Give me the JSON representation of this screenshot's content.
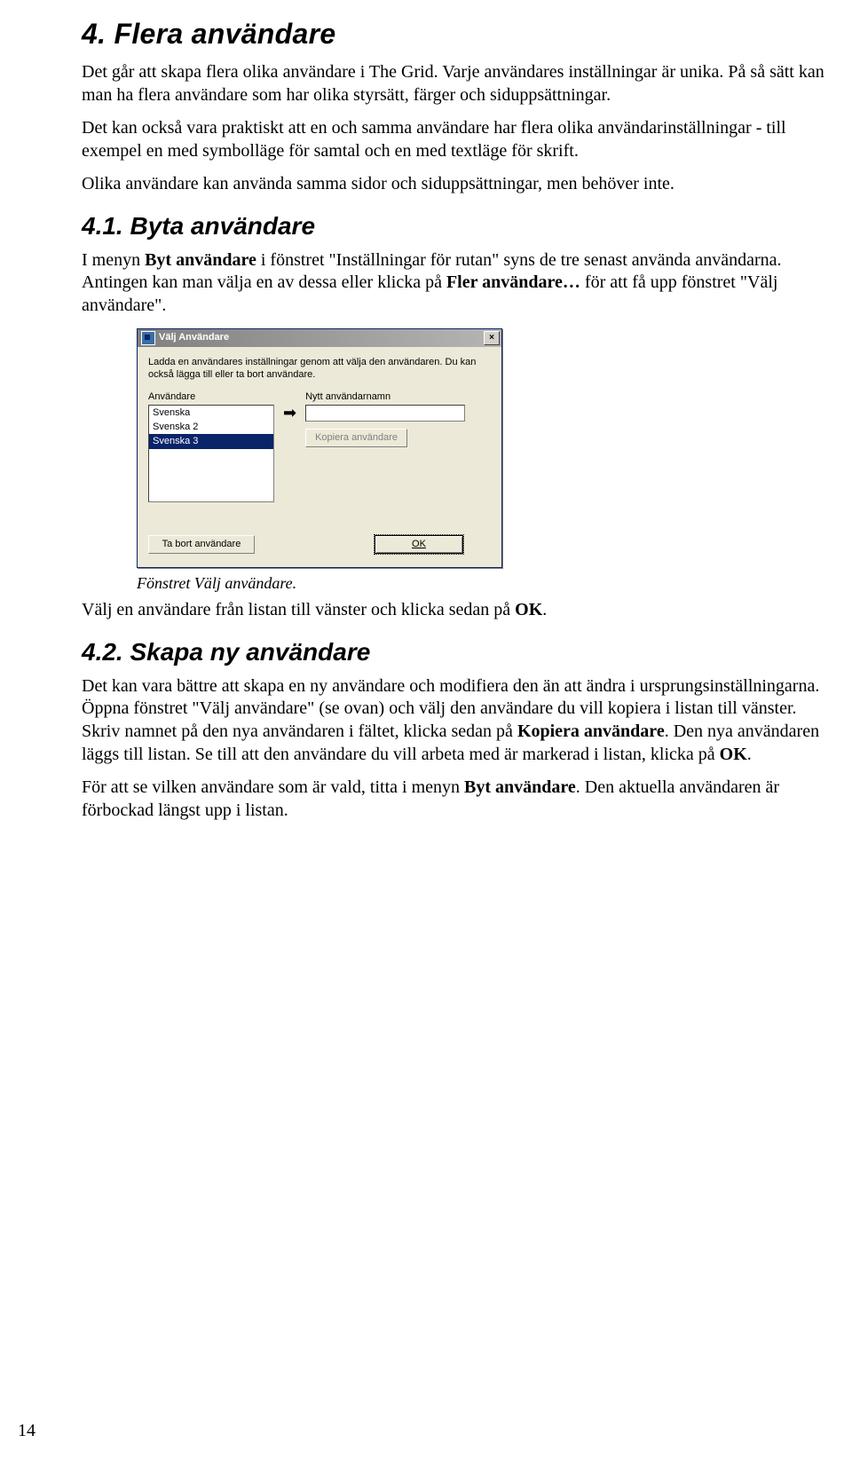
{
  "h1": "4. Flera användare",
  "p1a": "Det går att skapa flera olika användare i The Grid. Varje användares inställningar är unika. På så sätt kan man ha flera användare som har olika styrsätt, färger och siduppsättningar.",
  "p1b": "Det kan också vara praktiskt att en och samma användare har flera olika användarinställningar - till exempel en med symbolläge för samtal och en med textläge för skrift.",
  "p1c": "Olika användare kan använda samma sidor och siduppsättningar, men behöver inte.",
  "h2a": "4.1.  Byta användare",
  "p2a_pre": "I menyn ",
  "p2a_b1": "Byt användare",
  "p2a_mid": " i fönstret \"Inställningar för rutan\" syns de tre senast använda användarna. Antingen kan man välja en av dessa eller klicka på ",
  "p2a_b2": "Fler användare…",
  "p2a_post": " för att få upp fönstret \"Välj användare\".",
  "dialog": {
    "title": "Välj Användare",
    "info": "Ladda en användares inställningar genom att välja den användaren. Du kan också lägga till eller ta bort användare.",
    "label_left": "Användare",
    "label_right": "Nytt användarnamn",
    "items": [
      "Svenska",
      "Svenska 2",
      "Svenska 3"
    ],
    "btn_copy": "Kopiera användare",
    "btn_del": "Ta bort användare",
    "btn_ok": "OK",
    "close": "×"
  },
  "caption": "Fönstret Välj användare.",
  "p2b_pre": "Välj en användare från listan till vänster och klicka sedan på ",
  "p2b_b": "OK",
  "p2b_post": ".",
  "h2b": "4.2.  Skapa ny användare",
  "p3a_pre": "Det kan vara bättre att skapa en ny användare och modifiera den än att ändra i ursprungsinställningarna. Öppna fönstret \"Välj användare\" (se ovan) och välj den användare du vill kopiera i listan till vänster. Skriv namnet på den nya användaren i fältet, klicka sedan på ",
  "p3a_b1": "Kopiera användare",
  "p3a_mid": ". Den nya användaren läggs till listan. Se till att den användare du vill arbeta med är markerad i listan, klicka på ",
  "p3a_b2": "OK",
  "p3a_post": ".",
  "p3b_pre": "För att se vilken användare som är vald, titta i menyn ",
  "p3b_b": "Byt användare",
  "p3b_post": ". Den aktuella användaren är förbockad längst upp i listan.",
  "pagenum": "14"
}
